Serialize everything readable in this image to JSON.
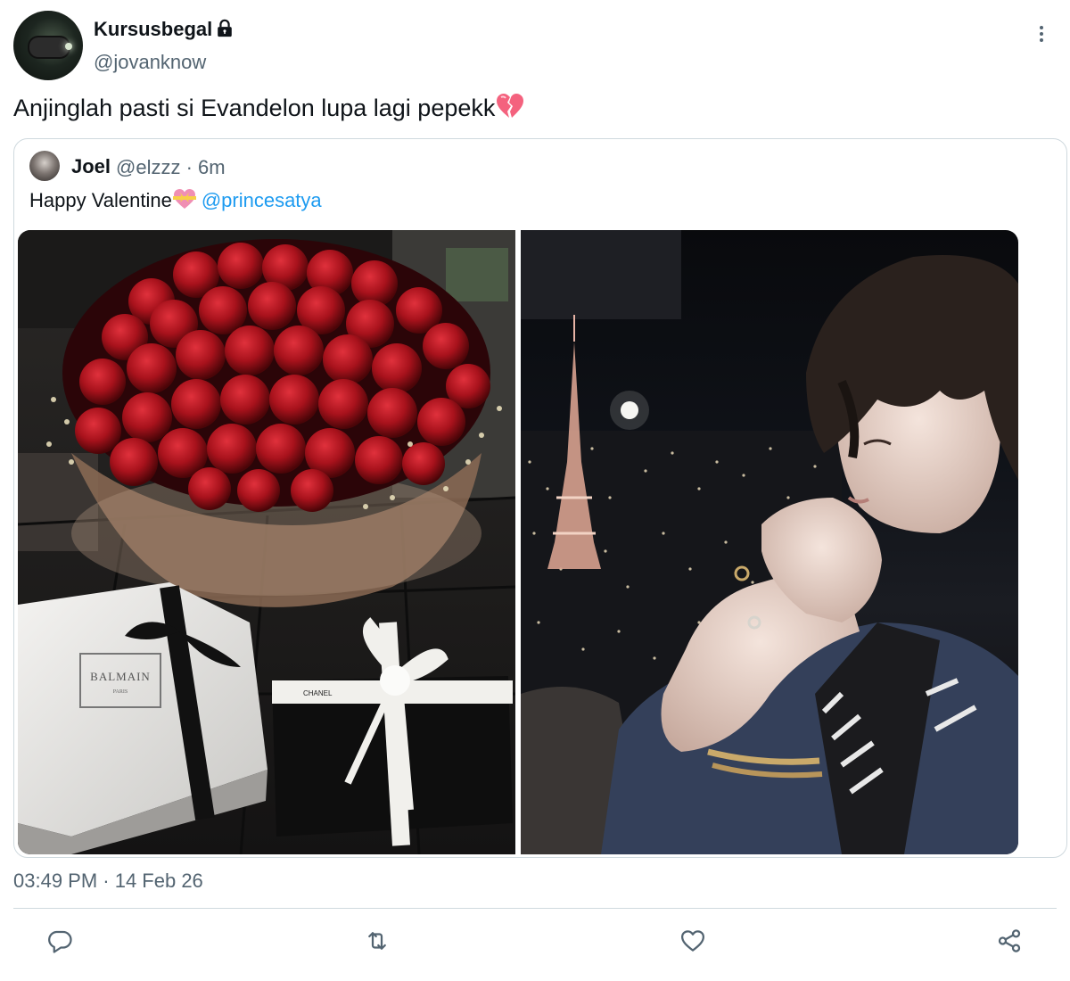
{
  "author": {
    "display_name": "Kursusbegal",
    "handle": "@jovanknow",
    "protected_icon": "lock-icon"
  },
  "tweet": {
    "text": "Anjinglah pasti si Evandelon lupa lagi pepekk",
    "emoji": "broken-heart-emoji",
    "timestamp": "03:49 PM · 14 Feb 26"
  },
  "quoted": {
    "display_name": "Joel",
    "meta": "@elzzz · 6m",
    "text": "Happy Valentine",
    "emoji": "heart-with-ribbon-emoji",
    "mention": "@princesatya",
    "images": [
      {
        "subject": "red-roses-bouquet-with-gift-boxes",
        "printed_text": [
          "BALMAIN",
          "PARIS",
          "CHANEL"
        ]
      },
      {
        "subject": "person-at-night-city-window-with-tower"
      }
    ]
  },
  "actions": [
    "reply-icon",
    "retweet-icon",
    "like-icon",
    "share-icon"
  ],
  "colors": {
    "text_primary": "#0f1419",
    "text_secondary": "#536471",
    "link": "#1d9bf0",
    "border": "#cfd9de"
  }
}
